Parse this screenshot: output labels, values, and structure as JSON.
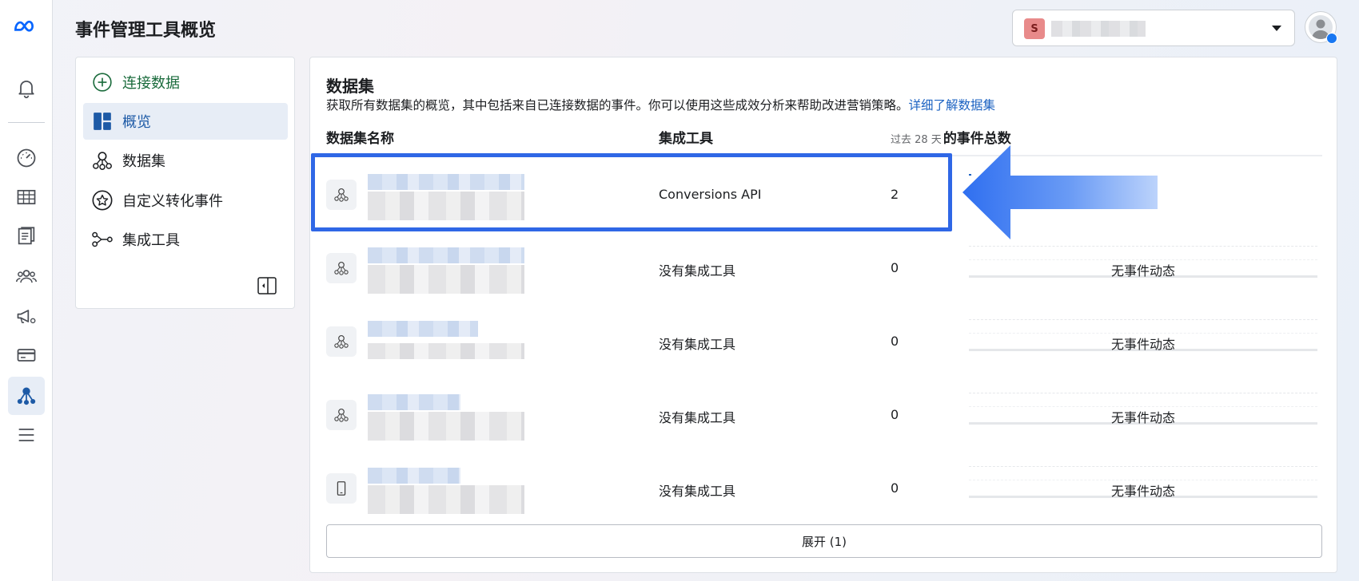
{
  "header": {
    "title": "事件管理工具概览",
    "account_badge": "S"
  },
  "menu": {
    "items": [
      {
        "label": "连接数据",
        "icon": "add-circle-icon"
      },
      {
        "label": "概览",
        "icon": "overview-grid-icon"
      },
      {
        "label": "数据集",
        "icon": "dataset-icon"
      },
      {
        "label": "自定义转化事件",
        "icon": "star-badge-icon"
      },
      {
        "label": "集成工具",
        "icon": "integration-icon"
      }
    ]
  },
  "datasets": {
    "title": "数据集",
    "description": "获取所有数据集的概览，其中包括来自已连接数据的事件。你可以使用这些成效分析来帮助改进营销策略。",
    "learn_more": "详细了解数据集",
    "columns": {
      "name": "数据集名称",
      "integration": "集成工具",
      "events_prefix": "过去 28 天",
      "events": "的事件总数"
    },
    "rows": [
      {
        "icon": "dataset-icon",
        "integration": "Conversions API",
        "count": "2",
        "activity": ""
      },
      {
        "icon": "dataset-icon",
        "integration": "没有集成工具",
        "count": "0",
        "activity": "无事件动态"
      },
      {
        "icon": "dataset-icon",
        "integration": "没有集成工具",
        "count": "0",
        "activity": "无事件动态"
      },
      {
        "icon": "dataset-icon",
        "integration": "没有集成工具",
        "count": "0",
        "activity": "无事件动态"
      },
      {
        "icon": "mobile-app-icon",
        "integration": "没有集成工具",
        "count": "0",
        "activity": "无事件动态"
      }
    ],
    "expand_label": "展开 (1)"
  },
  "colors": {
    "accent": "#1d63c2",
    "highlight": "#2f67e6",
    "connect_green": "#1a6b3c",
    "active_bg": "#e7edf6"
  }
}
